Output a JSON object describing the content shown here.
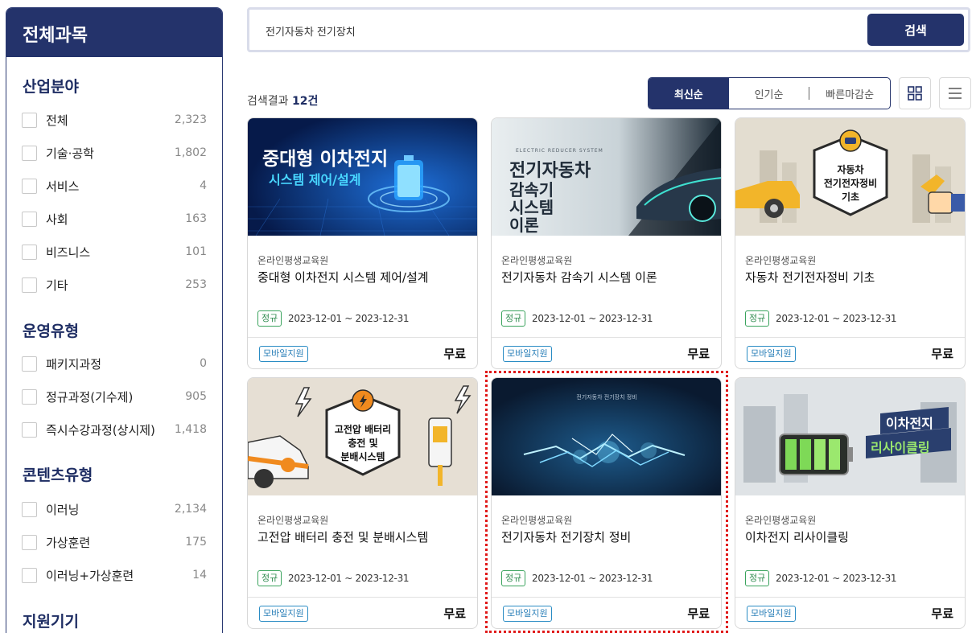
{
  "sidebar": {
    "title": "전체과목",
    "sections": [
      {
        "title": "산업분야",
        "options": [
          {
            "label": "전체",
            "count": "2,323"
          },
          {
            "label": "기술·공학",
            "count": "1,802"
          },
          {
            "label": "서비스",
            "count": "4"
          },
          {
            "label": "사회",
            "count": "163"
          },
          {
            "label": "비즈니스",
            "count": "101"
          },
          {
            "label": "기타",
            "count": "253"
          }
        ]
      },
      {
        "title": "운영유형",
        "options": [
          {
            "label": "패키지과정",
            "count": "0"
          },
          {
            "label": "정규과정(기수제)",
            "count": "905"
          },
          {
            "label": "즉시수강과정(상시제)",
            "count": "1,418"
          }
        ]
      },
      {
        "title": "콘텐츠유형",
        "options": [
          {
            "label": "이러닝",
            "count": "2,134"
          },
          {
            "label": "가상훈련",
            "count": "175"
          },
          {
            "label": "이러닝+가상훈련",
            "count": "14"
          }
        ]
      },
      {
        "title": "지원기기",
        "options": []
      }
    ]
  },
  "search": {
    "value": "전기자동차 전기장치",
    "button_label": "검색"
  },
  "results": {
    "prefix": "검색결과 ",
    "count": "12건"
  },
  "sort": {
    "options": [
      "최신순",
      "인기순",
      "빠른마감순"
    ],
    "active": "최신순"
  },
  "view_icons": [
    "grid-view-icon",
    "list-view-icon"
  ],
  "courses": [
    {
      "provider": "온라인평생교육원",
      "title": "중대형 이차전지 시스템 제어/설계",
      "thumb_lines": [
        "중대형 이차전지",
        "시스템 제어/설계"
      ],
      "type": "정규",
      "period": "2023-12-01 ~ 2023-12-31",
      "device": "모바일지원",
      "price": "무료"
    },
    {
      "provider": "온라인평생교육원",
      "title": "전기자동차 감속기 시스템 이론",
      "thumb_lines": [
        "ELECTRIC REDUCER SYSTEM",
        "전기자동차",
        "감속기",
        "시스템",
        "이론"
      ],
      "type": "정규",
      "period": "2023-12-01 ~ 2023-12-31",
      "device": "모바일지원",
      "price": "무료"
    },
    {
      "provider": "온라인평생교육원",
      "title": "자동차 전기전자정비 기초",
      "thumb_lines": [
        "자동차",
        "전기전자정비",
        "기초"
      ],
      "type": "정규",
      "period": "2023-12-01 ~ 2023-12-31",
      "device": "모바일지원",
      "price": "무료"
    },
    {
      "provider": "온라인평생교육원",
      "title": "고전압 배터리 충전 및 분배시스템",
      "thumb_lines": [
        "고전압 배터리",
        "충전 및",
        "분배시스템"
      ],
      "type": "정규",
      "period": "2023-12-01 ~ 2023-12-31",
      "device": "모바일지원",
      "price": "무료"
    },
    {
      "provider": "온라인평생교육원",
      "title": "전기자동차 전기장치 정비",
      "thumb_lines": [
        "전기자동차 전기장치 정비"
      ],
      "type": "정규",
      "period": "2023-12-01 ~ 2023-12-31",
      "device": "모바일지원",
      "price": "무료"
    },
    {
      "provider": "온라인평생교육원",
      "title": "이차전지 리사이클링",
      "thumb_lines": [
        "이차전지",
        "리사이클링"
      ],
      "type": "정규",
      "period": "2023-12-01 ~ 2023-12-31",
      "device": "모바일지원",
      "price": "무료"
    }
  ]
}
